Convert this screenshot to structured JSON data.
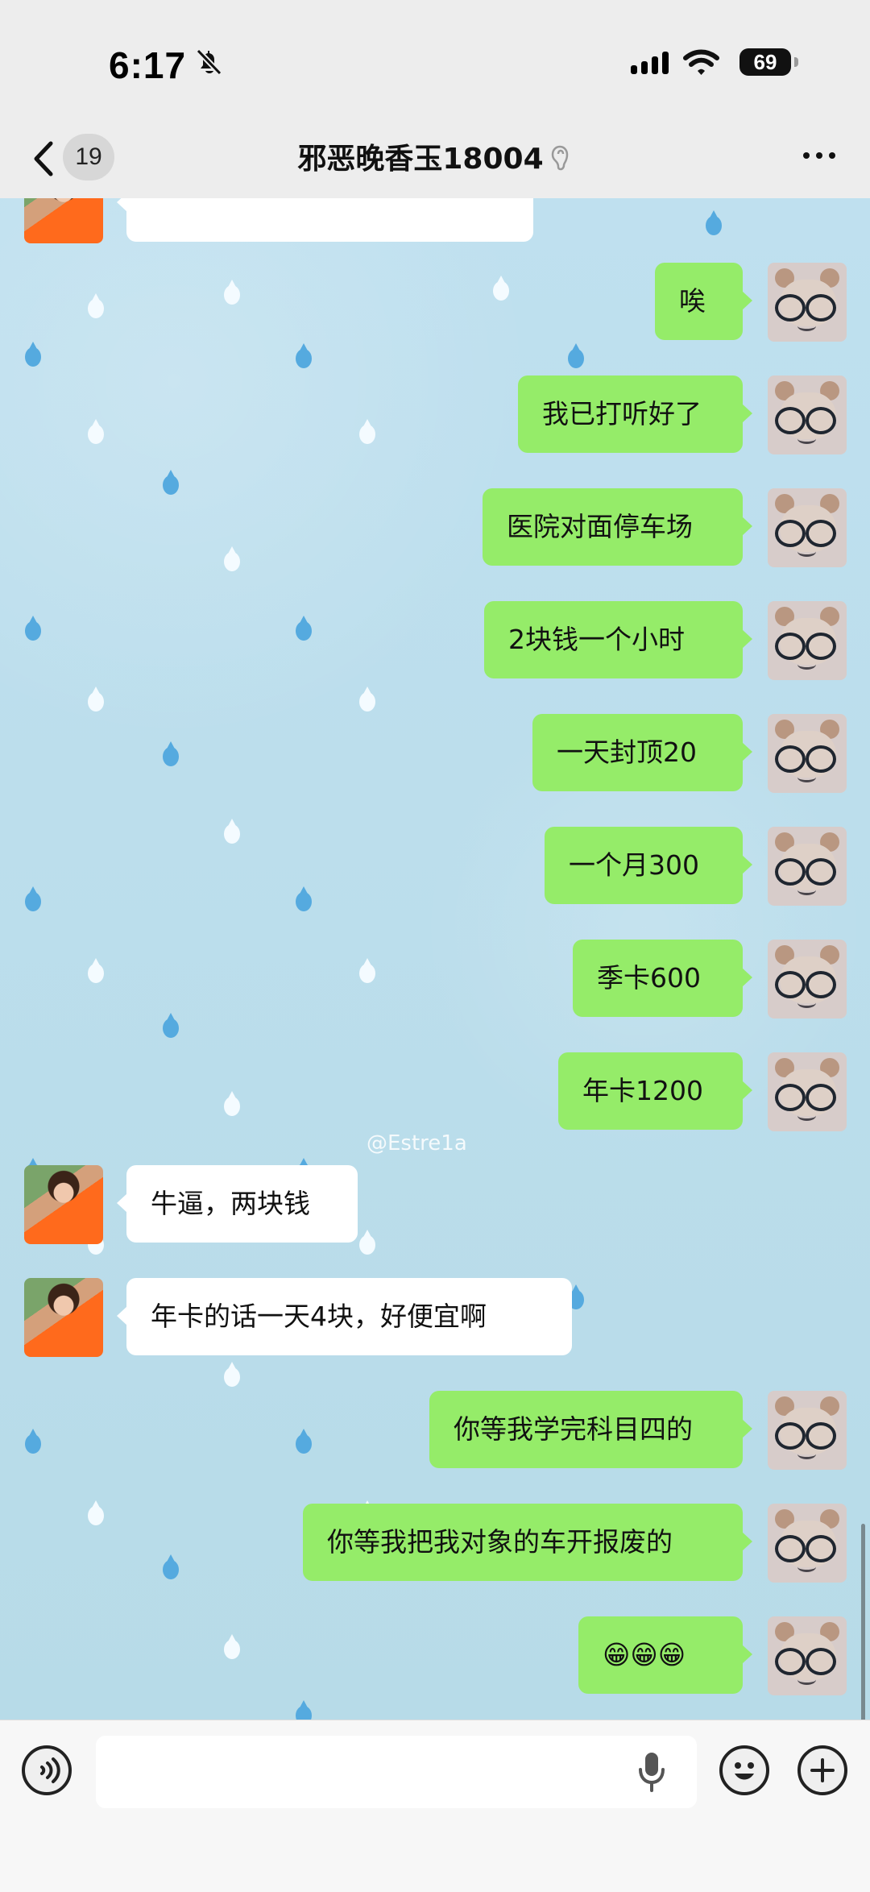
{
  "status_bar": {
    "time": "6:17",
    "battery": "69"
  },
  "header": {
    "unread_count": "19",
    "title": "邪恶晚香玉18004"
  },
  "watermark": "@Estre1a",
  "messages": [
    {
      "sender": "other",
      "text": ""
    },
    {
      "sender": "me",
      "text": "唉"
    },
    {
      "sender": "me",
      "text": "我已打听好了"
    },
    {
      "sender": "me",
      "text": "医院对面停车场"
    },
    {
      "sender": "me",
      "text": "2块钱一个小时"
    },
    {
      "sender": "me",
      "text": "一天封顶20"
    },
    {
      "sender": "me",
      "text": "一个月300"
    },
    {
      "sender": "me",
      "text": "季卡600"
    },
    {
      "sender": "me",
      "text": "年卡1200"
    },
    {
      "sender": "other",
      "text": "牛逼，两块钱"
    },
    {
      "sender": "other",
      "text": "年卡的话一天4块，好便宜啊"
    },
    {
      "sender": "me",
      "text": "你等我学完科目四的"
    },
    {
      "sender": "me",
      "text": "你等我把我对象的车开报废的"
    },
    {
      "sender": "me",
      "text": "😁😁😁"
    }
  ],
  "input": {
    "placeholder": ""
  },
  "icons": {
    "back": "chevron-left-icon",
    "ear": "ear-icon",
    "more": "more-icon",
    "voice": "voice-icon",
    "mic": "microphone-icon",
    "emoji": "emoji-icon",
    "plus": "plus-icon"
  },
  "colors": {
    "my_bubble": "#95ec69",
    "other_bubble": "#ffffff",
    "chat_background": "#bfe0ef"
  }
}
